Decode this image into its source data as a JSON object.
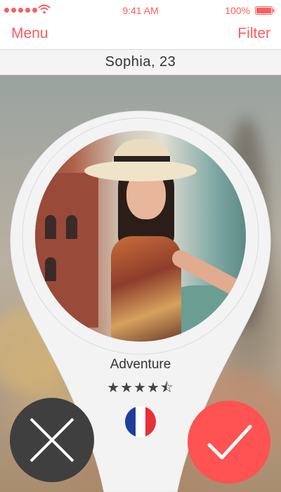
{
  "status_bar": {
    "time": "9:41 AM",
    "battery": "100%",
    "signal_icon": "signal-dots-icon",
    "wifi_icon": "wifi-icon",
    "battery_icon": "battery-icon"
  },
  "nav": {
    "left_label": "Menu",
    "right_label": "Filter"
  },
  "profile": {
    "name_age": "Sophia, 23",
    "tagline": "Adventure",
    "rating_display": "★★★★⯪",
    "rating": 4.5,
    "rating_max": 5,
    "country_flag": "france-flag-icon"
  },
  "actions": {
    "reject_icon": "close-icon",
    "accept_icon": "check-icon"
  },
  "colors": {
    "accent": "#ff5b5b",
    "reject_button": "#3f3f3f",
    "accept_button": "#ff5252",
    "flag_blue": "#1f3f9c",
    "flag_white": "#ffffff",
    "flag_red": "#e8303a"
  }
}
